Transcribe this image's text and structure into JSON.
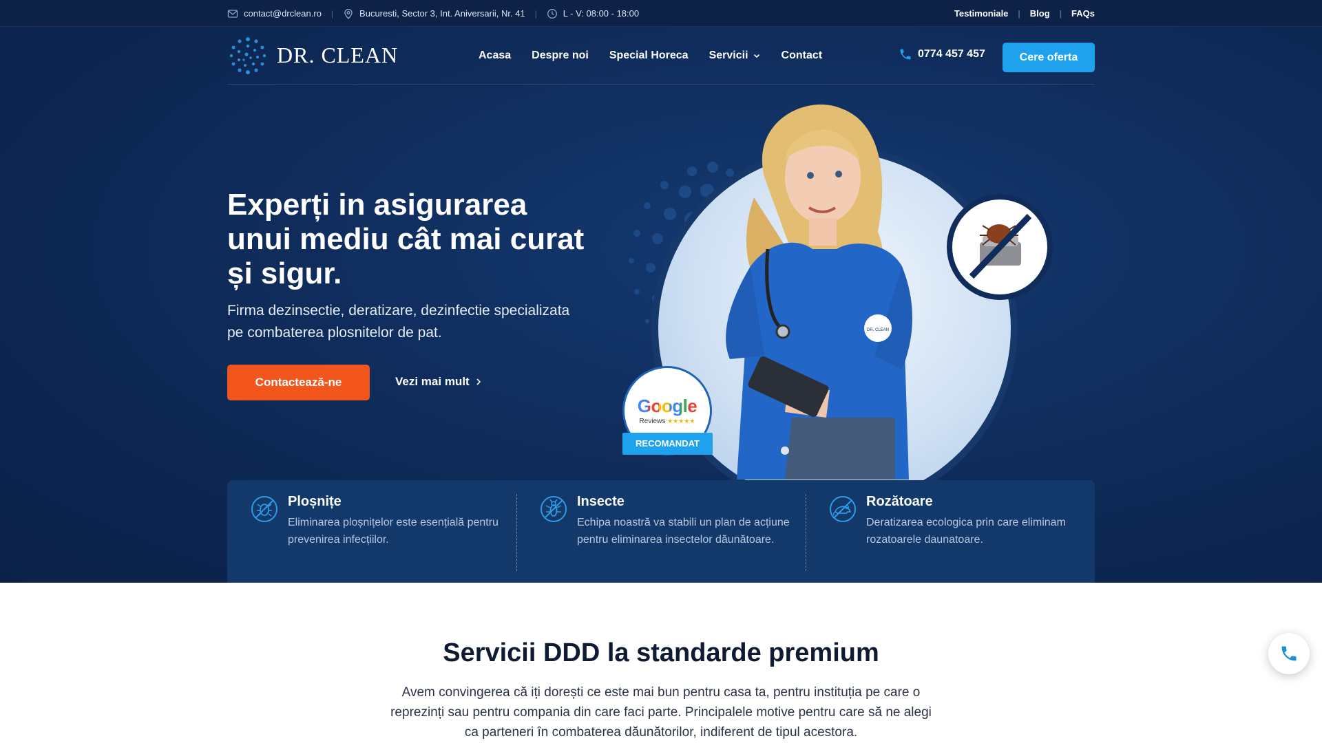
{
  "topbar": {
    "email": "contact@drclean.ro",
    "address": "Bucuresti, Sector 3, Int. Aniversarii, Nr. 41",
    "hours": "L - V: 08:00 - 18:00",
    "links": [
      "Testimoniale",
      "Blog",
      "FAQs"
    ],
    "separator": "|"
  },
  "nav": {
    "logo": "DR. CLEAN",
    "menu": [
      "Acasa",
      "Despre noi",
      "Special Horeca",
      "Servicii",
      "Contact"
    ],
    "phone": "0774 457 457",
    "cta": "Cere oferta"
  },
  "hero": {
    "title": "Experți in asigurarea unui mediu cât mai curat și sigur.",
    "subtitle": "Firma dezinsectie, deratizare, dezinfectie specializata pe combaterea plosnitelor de pat.",
    "primary_button": "Contactează-ne",
    "secondary_link": "Vezi mai mult",
    "google_word": "Google",
    "google_reviews": "Reviews",
    "badge": "RECOMANDAT",
    "logo_on_shirt": "DR. CLEAN"
  },
  "features": [
    {
      "title": "Ploșnițe",
      "text": "Eliminarea ploșnițelor este esențială pentru prevenirea infecțiilor.",
      "icon": "bedbug-icon"
    },
    {
      "title": "Insecte",
      "text": "Echipa noastră va stabili un plan de acțiune pentru eliminarea insectelor dăunătoare.",
      "icon": "insect-icon"
    },
    {
      "title": "Rozătoare",
      "text": "Deratizarea ecologica prin care eliminam rozatoarele daunatoare.",
      "icon": "rodent-icon"
    }
  ],
  "section": {
    "title": "Servicii DDD la standarde premium",
    "text": "Avem convingerea că iți dorești ce este mai bun pentru casa ta, pentru instituția pe care o reprezinți sau pentru compania din care faci parte. Principalele motive pentru care să ne alegi ca parteneri în combaterea dăunătorilor, indiferent de tipul acestora."
  },
  "colors": {
    "navy": "#0f2c5b",
    "accent_blue": "#1ea2ee",
    "accent_orange": "#f2561d"
  }
}
